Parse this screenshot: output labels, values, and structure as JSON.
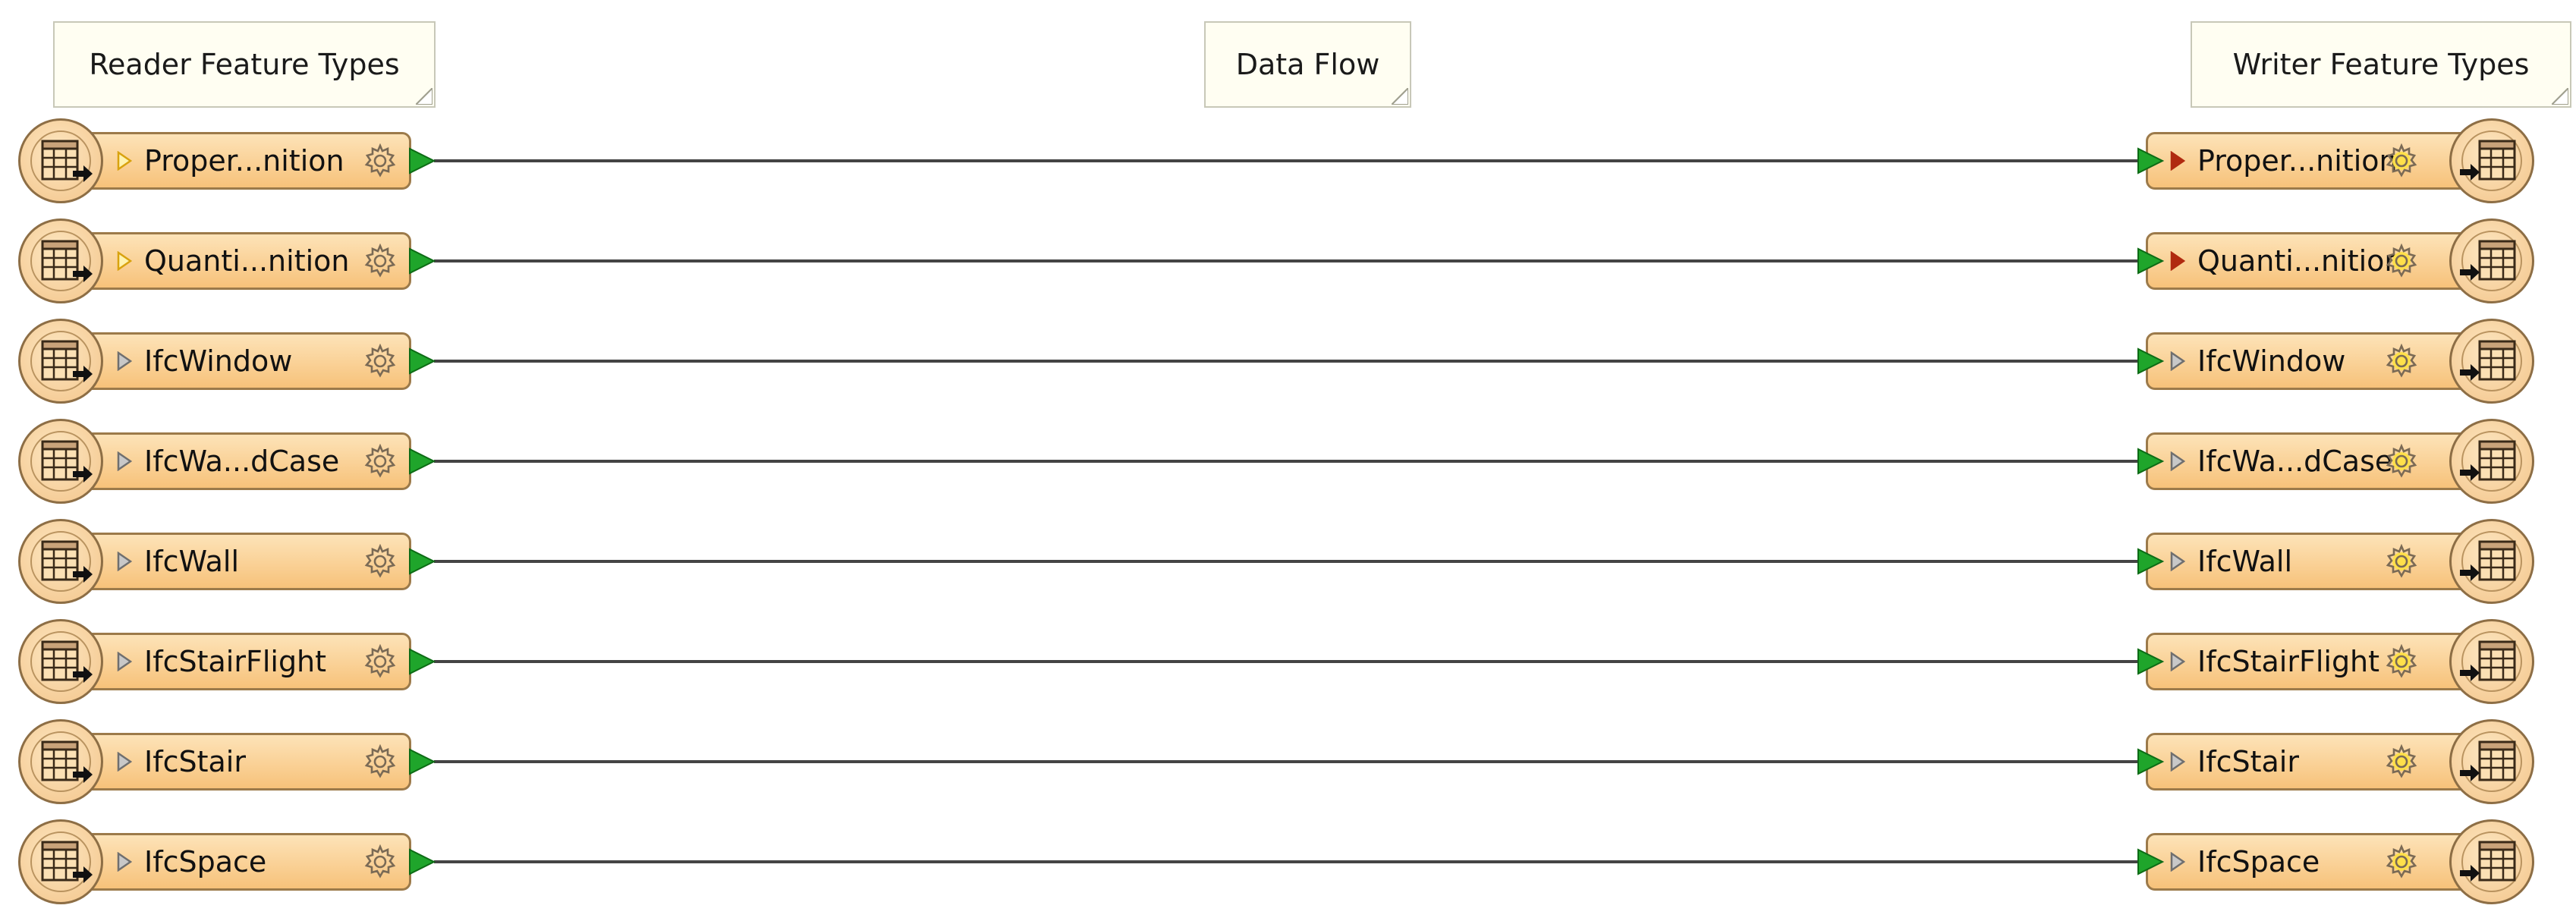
{
  "annotations": {
    "reader": "Reader Feature Types",
    "dataflow": "Data Flow",
    "writer": "Writer Feature Types"
  },
  "colors": {
    "node_fill": "#f7c27a",
    "node_border": "#9c7a4a",
    "port_green": "#1fa52b",
    "connection_line": "#444444",
    "writer_triangle_active": "#b02a10",
    "triangle_gray": "#6f6f6f"
  },
  "icons": {
    "reader_node_icon": "table-with-arrow-icon",
    "writer_node_icon": "arrow-into-table-icon",
    "expand_icon": "triangle-right-icon",
    "settings_icon": "gear-icon",
    "port_icon": "green-arrow-port-icon"
  },
  "rows": [
    {
      "reader_label": "Proper...nition",
      "writer_label": "Proper...nition",
      "reader_triangle": "yellow",
      "writer_triangle": "red"
    },
    {
      "reader_label": "Quanti...nition",
      "writer_label": "Quanti...nition",
      "reader_triangle": "yellow",
      "writer_triangle": "red"
    },
    {
      "reader_label": "IfcWindow",
      "writer_label": "IfcWindow",
      "reader_triangle": "gray",
      "writer_triangle": "gray"
    },
    {
      "reader_label": "IfcWa...dCase",
      "writer_label": "IfcWa...dCase",
      "reader_triangle": "gray",
      "writer_triangle": "gray"
    },
    {
      "reader_label": "IfcWall",
      "writer_label": "IfcWall",
      "reader_triangle": "gray",
      "writer_triangle": "gray"
    },
    {
      "reader_label": "IfcStairFlight",
      "writer_label": "IfcStairFlight",
      "reader_triangle": "gray",
      "writer_triangle": "gray"
    },
    {
      "reader_label": "IfcStair",
      "writer_label": "IfcStair",
      "reader_triangle": "gray",
      "writer_triangle": "gray"
    },
    {
      "reader_label": "IfcSpace",
      "writer_label": "IfcSpace",
      "reader_triangle": "gray",
      "writer_triangle": "gray"
    }
  ]
}
